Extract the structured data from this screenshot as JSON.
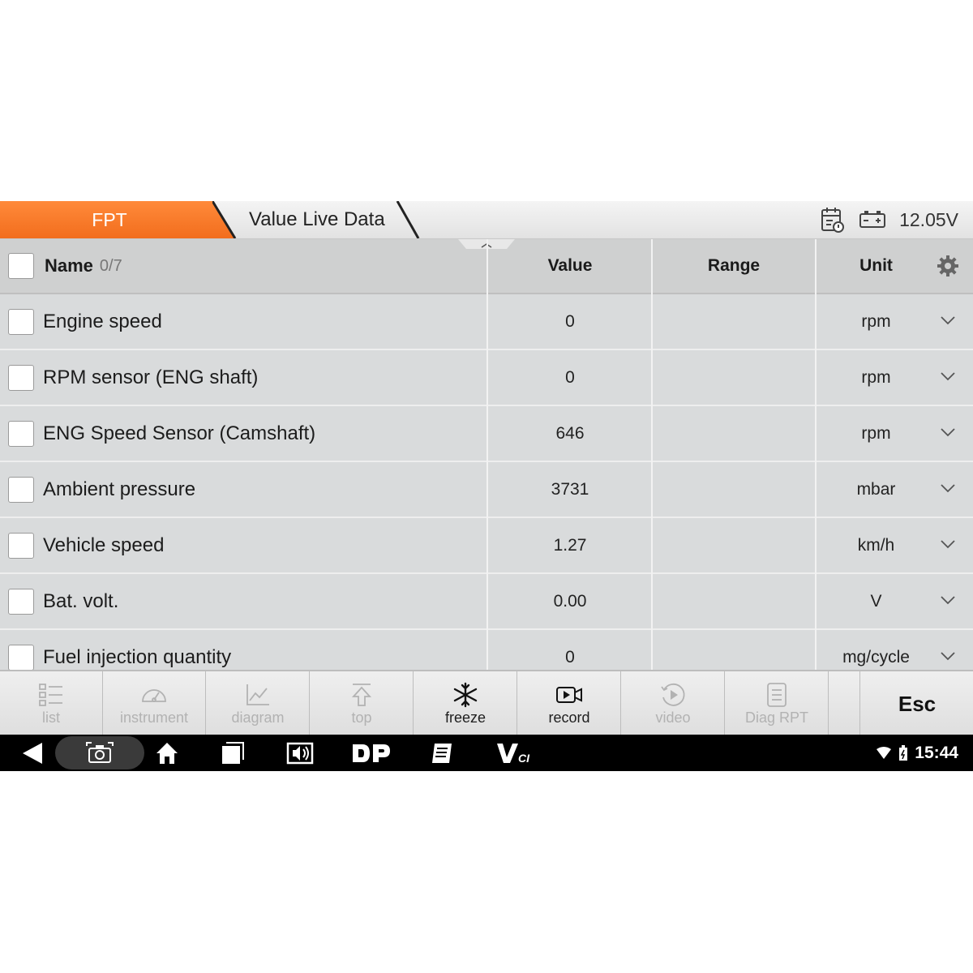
{
  "topbar": {
    "tab_fpt": "FPT",
    "tab_live": "Value Live Data",
    "voltage": "12.05V"
  },
  "table": {
    "headers": {
      "name": "Name",
      "count": "0/7",
      "value": "Value",
      "range": "Range",
      "unit": "Unit"
    },
    "rows": [
      {
        "name": "Engine speed",
        "value": "0",
        "range": "",
        "unit": "rpm"
      },
      {
        "name": "RPM sensor (ENG shaft)",
        "value": "0",
        "range": "",
        "unit": "rpm"
      },
      {
        "name": "ENG Speed Sensor (Camshaft)",
        "value": "646",
        "range": "",
        "unit": "rpm"
      },
      {
        "name": "Ambient pressure",
        "value": "3731",
        "range": "",
        "unit": "mbar"
      },
      {
        "name": "Vehicle speed",
        "value": "1.27",
        "range": "",
        "unit": "km/h"
      },
      {
        "name": "Bat. volt.",
        "value": "0.00",
        "range": "",
        "unit": "V"
      },
      {
        "name": "Fuel injection quantity",
        "value": "0",
        "range": "",
        "unit": "mg/cycle"
      }
    ]
  },
  "toolbar": {
    "list": "list",
    "instrument": "instrument",
    "diagram": "diagram",
    "top": "top",
    "freeze": "freeze",
    "record": "record",
    "video": "video",
    "diag_rpt": "Diag RPT",
    "esc": "Esc"
  },
  "navbar": {
    "time": "15:44"
  },
  "colors": {
    "accent": "#f26d1d",
    "row_bg": "#d9dbdc",
    "header_bg": "#cfd0d0"
  }
}
